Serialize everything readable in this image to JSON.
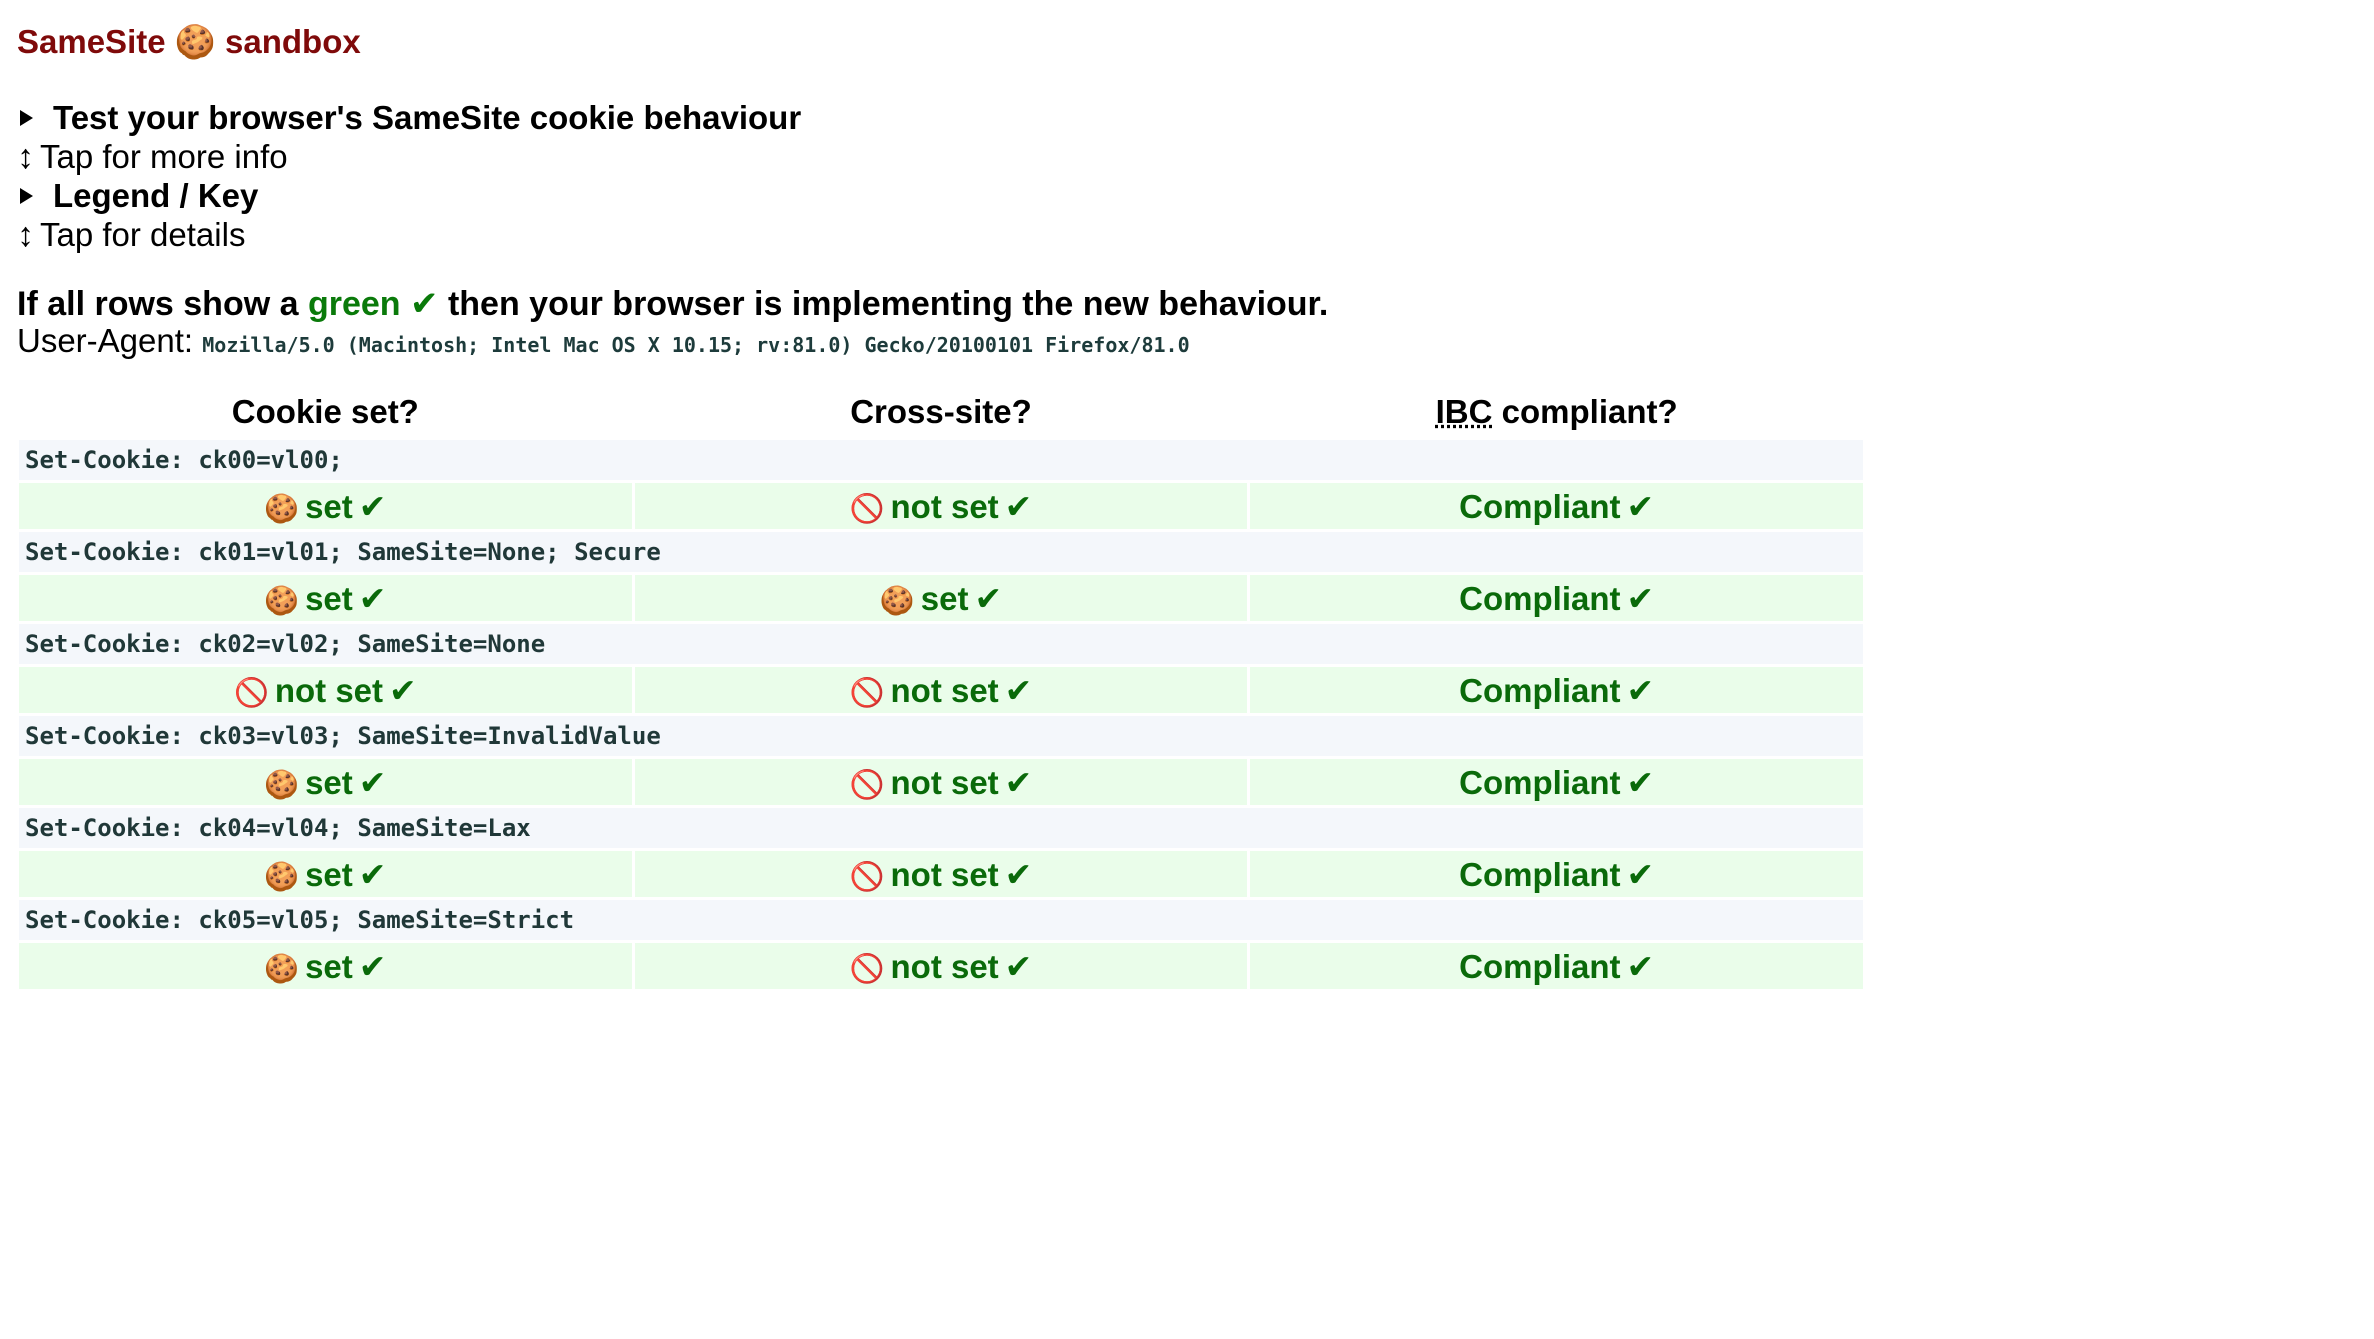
{
  "title": {
    "prefix": "SameSite",
    "cookie_emoji": "🍪",
    "suffix": "sandbox"
  },
  "sections": [
    {
      "summary": "Test your browser's SameSite cookie behaviour",
      "hint": "Tap for more info"
    },
    {
      "summary": "Legend / Key",
      "hint": "Tap for details"
    }
  ],
  "hint_arrow": "↕",
  "statement": {
    "before": "If all rows show a",
    "green_word": "green",
    "check": "✔",
    "after": "then your browser is implementing the new behaviour."
  },
  "user_agent": {
    "label": "User-Agent:",
    "value": "Mozilla/5.0 (Macintosh; Intel Mac OS X 10.15; rv:81.0) Gecko/20100101 Firefox/81.0"
  },
  "table": {
    "headers": {
      "cookie_set": "Cookie set?",
      "cross_site": "Cross-site?",
      "ibc_abbr": "IBC",
      "ibc_rest": "compliant?"
    },
    "check": "✔",
    "cookie_emoji": "🍪",
    "blocked_emoji": "🚫",
    "rows": [
      {
        "header": "Set-Cookie: ck00=vl00;",
        "cookie_set": "set",
        "cookie_set_icon": "🍪",
        "cross_site": "not set",
        "cross_site_icon": "🚫",
        "compliance": "Compliant"
      },
      {
        "header": "Set-Cookie: ck01=vl01; SameSite=None; Secure",
        "cookie_set": "set",
        "cookie_set_icon": "🍪",
        "cross_site": "set",
        "cross_site_icon": "🍪",
        "compliance": "Compliant"
      },
      {
        "header": "Set-Cookie: ck02=vl02; SameSite=None",
        "cookie_set": "not set",
        "cookie_set_icon": "🚫",
        "cross_site": "not set",
        "cross_site_icon": "🚫",
        "compliance": "Compliant"
      },
      {
        "header": "Set-Cookie: ck03=vl03; SameSite=InvalidValue",
        "cookie_set": "set",
        "cookie_set_icon": "🍪",
        "cross_site": "not set",
        "cross_site_icon": "🚫",
        "compliance": "Compliant"
      },
      {
        "header": "Set-Cookie: ck04=vl04; SameSite=Lax",
        "cookie_set": "set",
        "cookie_set_icon": "🍪",
        "cross_site": "not set",
        "cross_site_icon": "🚫",
        "compliance": "Compliant"
      },
      {
        "header": "Set-Cookie: ck05=vl05; SameSite=Strict",
        "cookie_set": "set",
        "cookie_set_icon": "🍪",
        "cross_site": "not set",
        "cross_site_icon": "🚫",
        "compliance": "Compliant"
      }
    ]
  },
  "colors": {
    "title": "#7f0a0a",
    "green": "#0a7a0a",
    "row_bg": "#eafdea",
    "header_bg": "#f4f7fb"
  }
}
